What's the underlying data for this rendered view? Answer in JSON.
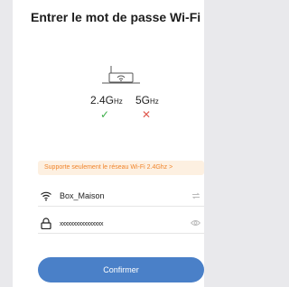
{
  "title": "Entrer le mot de passe Wi-Fi",
  "bands": {
    "band24_num": "2.4G",
    "band24_unit": "Hz",
    "band5_num": "5G",
    "band5_unit": "Hz",
    "check": "✓",
    "cross": "✕"
  },
  "notice": "Supporte seulement le réseau Wi-Fi 2.4Ghz >",
  "wifi_field": {
    "value": "Box_Maison",
    "icon": "wifi-icon",
    "right_icon": "swap-icon"
  },
  "password_field": {
    "value": "xxxxxxxxxxxxxxxx",
    "icon": "lock-icon",
    "right_icon": "eye-icon"
  },
  "confirm_label": "Confirmer",
  "colors": {
    "accent": "#4a80c8",
    "ok": "#3cae48",
    "ko": "#e05a4f",
    "notice_text": "#f0842a",
    "notice_bg": "#fdf0e1"
  }
}
